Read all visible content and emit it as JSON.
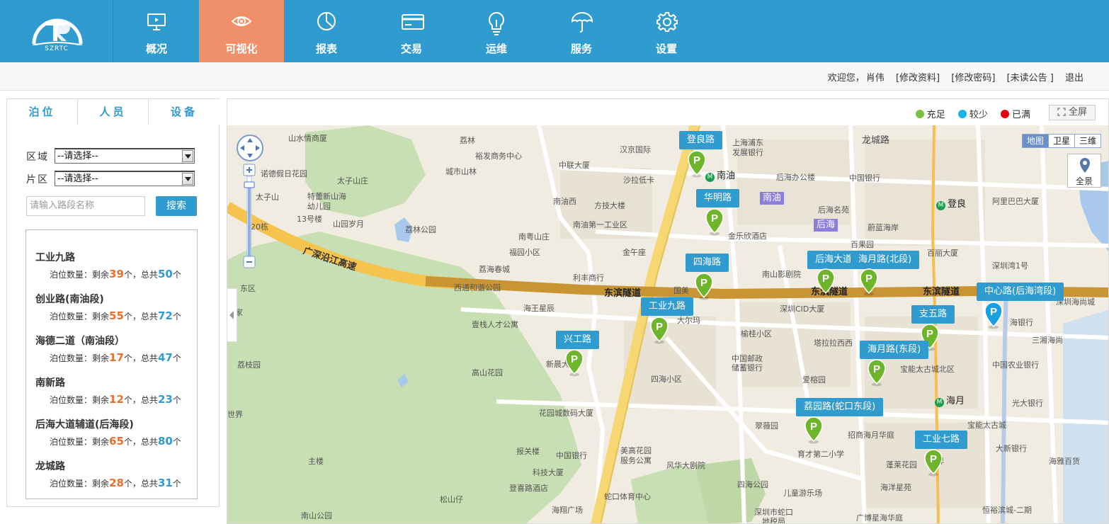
{
  "brand": {
    "logo_text": "SZRTC"
  },
  "nav": {
    "items": [
      {
        "label": "概况",
        "icon": "monitor-icon"
      },
      {
        "label": "可视化",
        "icon": "eye-icon",
        "active": true
      },
      {
        "label": "报表",
        "icon": "pie-chart-icon"
      },
      {
        "label": "交易",
        "icon": "card-icon"
      },
      {
        "label": "运维",
        "icon": "lightbulb-icon"
      },
      {
        "label": "服务",
        "icon": "umbrella-icon"
      },
      {
        "label": "设置",
        "icon": "gear-icon"
      }
    ]
  },
  "userbar": {
    "welcome": "欢迎您，",
    "user": "肖伟",
    "edit_profile": "[修改资料]",
    "change_password": "[修改密码]",
    "unread_notice": "[未读公告 ]",
    "logout": "退出"
  },
  "left": {
    "tabs": [
      "泊位",
      "人员",
      "设备"
    ],
    "area_label": "区域",
    "zone_label": "片区",
    "area_value": "--请选择--",
    "zone_value": "--请选择--",
    "search_placeholder": "请输入路段名称",
    "search_button": "搜索",
    "count_prefix": "泊位数量：",
    "remain_prefix": "剩余",
    "unit": "个",
    "total_prefix": "，总共",
    "roads": [
      {
        "name": "工业九路",
        "remain": "39",
        "total": "50"
      },
      {
        "name": "创业路(南油段)",
        "remain": "55",
        "total": "72"
      },
      {
        "name": "海德二道（南油段）",
        "remain": "17",
        "total": "47"
      },
      {
        "name": "南新路",
        "remain": "12",
        "total": "23"
      },
      {
        "name": "后海大道辅道(后海段)",
        "remain": "65",
        "total": "80"
      },
      {
        "name": "龙城路",
        "remain": "28",
        "total": "31"
      }
    ]
  },
  "map": {
    "legend": [
      {
        "label": "充足",
        "color": "#7ac143"
      },
      {
        "label": "较少",
        "color": "#1ab3e8"
      },
      {
        "label": "已满",
        "color": "#e60012"
      }
    ],
    "fullscreen": "全屏",
    "map_types": [
      "地图",
      "卫星",
      "三维"
    ],
    "panorama": "全景",
    "colors": {
      "sufficient": "#6fb52c",
      "few": "#1a9fe0",
      "label_bg": "#2f9bcf"
    },
    "parking": [
      {
        "name": "登良路",
        "status": "sufficient"
      },
      {
        "name": "华明路",
        "status": "sufficient"
      },
      {
        "name": "四海路",
        "status": "sufficient"
      },
      {
        "name": "后海大道",
        "status": "sufficient"
      },
      {
        "name": "海月路(北段)",
        "status": "sufficient"
      },
      {
        "name": "中心路(后海湾段)",
        "status": "few"
      },
      {
        "name": "工业九路",
        "status": "sufficient"
      },
      {
        "name": "支五路",
        "status": "sufficient"
      },
      {
        "name": "兴工路",
        "status": "sufficient"
      },
      {
        "name": "海月路(东段)",
        "status": "sufficient"
      },
      {
        "name": "荔园路(蛇口东段)",
        "status": "sufficient"
      },
      {
        "name": "工业七路",
        "status": "sufficient"
      }
    ],
    "roads": {
      "expressway": "广深沿江高速",
      "tunnel1": "东滨隧道",
      "tunnel2": "东滨隧道",
      "tunnel3": "东滨隧道",
      "longcheng": "龙城路"
    },
    "districts": [
      "南油",
      "后海"
    ],
    "metro": [
      "南油",
      "登良",
      "海月"
    ],
    "places": [
      "山水情商厦",
      "荔林",
      "裕发商务中心",
      "汉京国际",
      "上海浦东",
      "发展银行",
      "诺德假日花园",
      "城市山林",
      "中联大厦",
      "太子山庄",
      "沙拉低卡",
      "后海办公楼",
      "中国银行",
      "太子山",
      "特蕾新山海",
      "幼儿园",
      "南油西",
      "方技大楼",
      "阿里巴巴大厦",
      "13号楼",
      "山园岁月",
      "荔林公园",
      "南油第一工业区",
      "后海名苑",
      "20栋",
      "南粤山庄",
      "蔚蓝海岸",
      "金乐欣酒店",
      "福园小区",
      "金午座",
      "百果园",
      "荔海春城",
      "南山影剧院",
      "利丰商行",
      "百丽大厦",
      "深圳湾1号",
      "西通和谐公园",
      "国美",
      "东区",
      "海王星辰",
      "深圳CID大厦",
      "深圳海尚城",
      "王家",
      "壹栈人才公寓",
      "大尔玛",
      "海银行",
      "榆桂小区",
      "塔拉拉西西",
      "三湘海尚",
      "荔枝园",
      "新晨大厦",
      "高山花园",
      "中国邮政",
      "储蓄银行",
      "四海小区",
      "爱榕园",
      "宝能太古城北区",
      "中国农业银行",
      "花园城数码大厦",
      "世界",
      "文",
      "光大银行",
      "翠薇园",
      "招商海月华庭",
      "宝能太古城",
      "报关楼",
      "中国银行",
      "美高花园",
      "服务公寓",
      "育才第二小学",
      "大新银行",
      "主楼",
      "科技大厦",
      "风华大剧院",
      "海雅百货",
      "吉祥",
      "蓬莱花园",
      "登喜路酒店",
      "四海公园",
      "儿童游乐场",
      "海洋星苑",
      "松山仔",
      "蛇口体育中心",
      "广博星海华庭",
      "恒裕滨城-二期",
      "海翔广场",
      "深圳市蛇口",
      "地税局",
      "南山公园"
    ]
  }
}
